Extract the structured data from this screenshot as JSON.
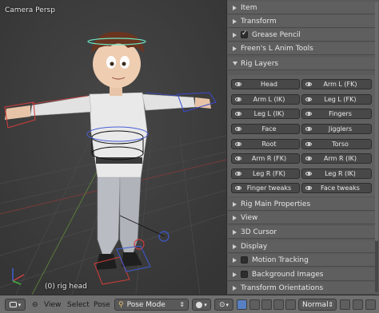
{
  "viewport": {
    "view_label": "Camera Persp",
    "object_label": "(0) rig head"
  },
  "panel": {
    "sections_top": [
      {
        "label": "Item",
        "open": false,
        "checkbox": false
      },
      {
        "label": "Transform",
        "open": false,
        "checkbox": false
      },
      {
        "label": "Grease Pencil",
        "open": false,
        "checkbox": true,
        "checked": true
      },
      {
        "label": "Freen's L Anim Tools",
        "open": false,
        "checkbox": false
      },
      {
        "label": "Rig Layers",
        "open": true,
        "checkbox": false
      }
    ],
    "rig_layers": [
      [
        "Head",
        "Arm L (FK)"
      ],
      [
        "Arm L (IK)",
        "Leg L (FK)"
      ],
      [
        "Leg L (IK)",
        "Fingers"
      ],
      [
        "Face",
        "Jigglers"
      ],
      [
        "Root",
        "Torso"
      ],
      [
        "Arm R (FK)",
        "Arm R (IK)"
      ],
      [
        "Leg R (FK)",
        "Leg R (IK)"
      ],
      [
        "Finger tweaks",
        "Face tweaks"
      ]
    ],
    "sections_bottom": [
      {
        "label": "Rig Main Properties",
        "checkbox": false
      },
      {
        "label": "View",
        "checkbox": false
      },
      {
        "label": "3D Cursor",
        "checkbox": false
      },
      {
        "label": "Display",
        "checkbox": false
      },
      {
        "label": "Motion Tracking",
        "checkbox": true,
        "checked": false
      },
      {
        "label": "Background Images",
        "checkbox": true,
        "checked": false
      },
      {
        "label": "Transform Orientations",
        "checkbox": false
      }
    ]
  },
  "header": {
    "menu_view": "View",
    "menu_select": "Select",
    "menu_pose": "Pose",
    "mode": "Pose Mode",
    "shading": "Normal"
  },
  "colors": {
    "panel_bg": "#5a5a5a",
    "viewport_bg": "#3d3d3d",
    "header_bg": "#707070",
    "selection_blue": "#5680c2"
  }
}
